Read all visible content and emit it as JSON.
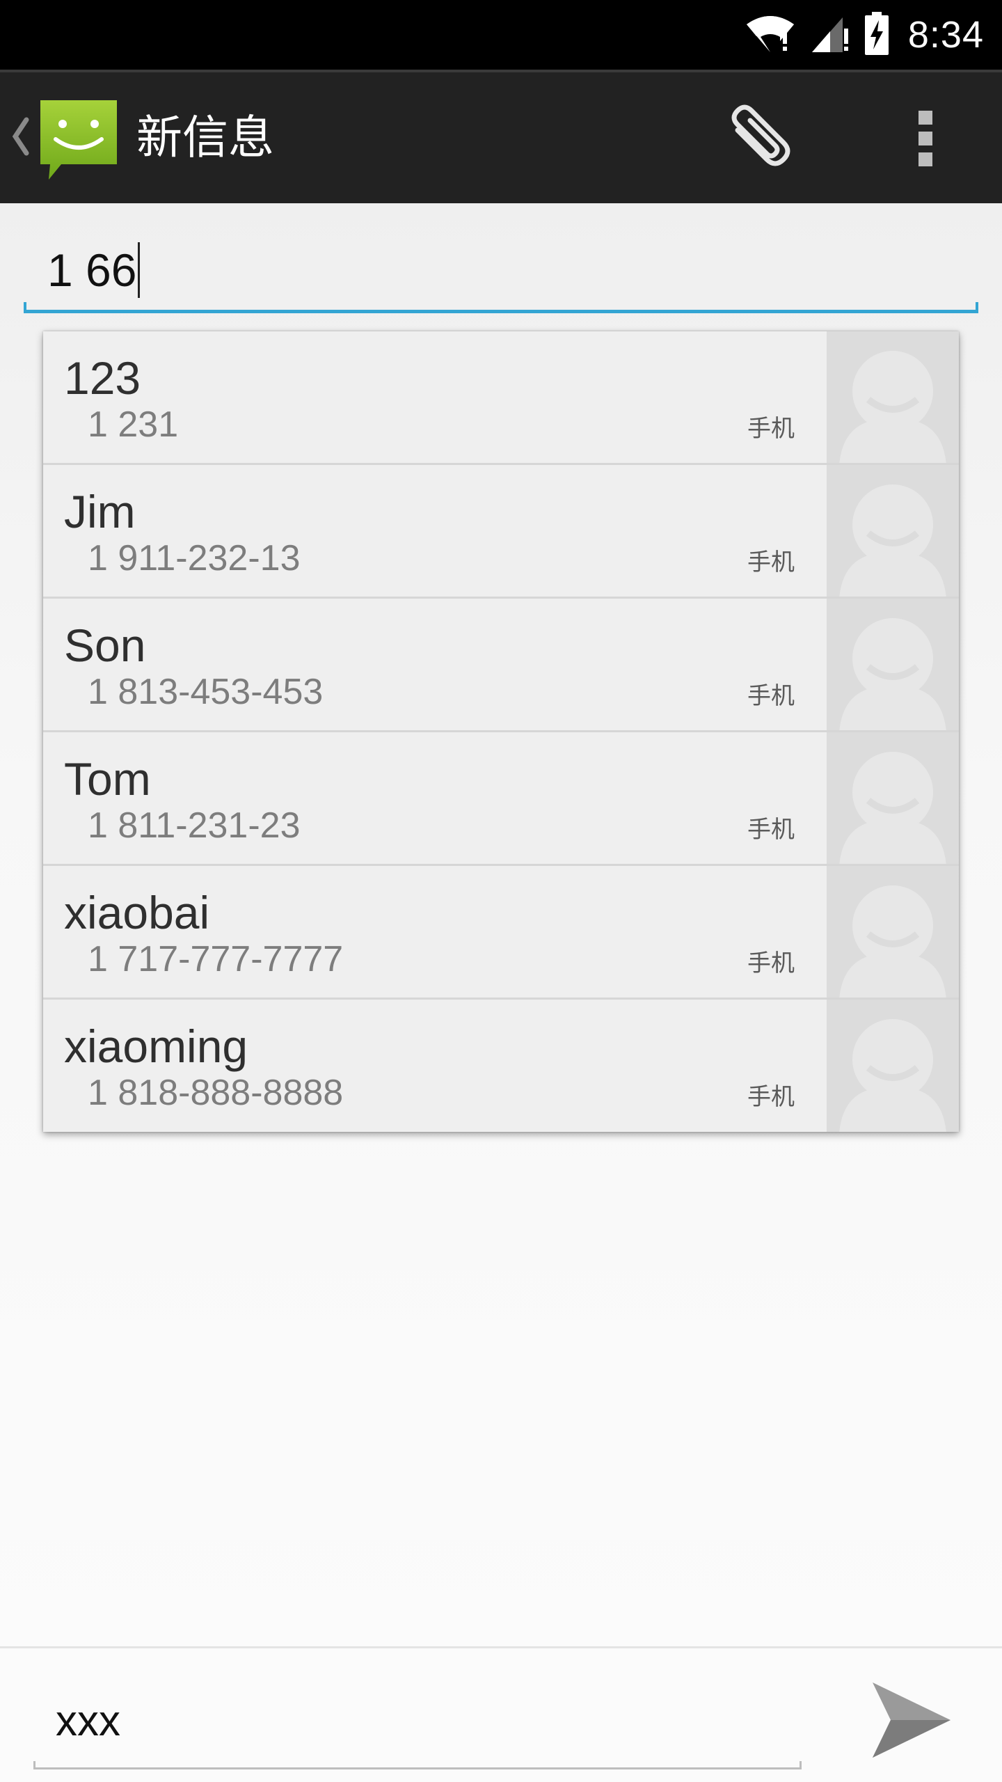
{
  "status_bar": {
    "time": "8:34",
    "icons": [
      "wifi-no-internet-icon",
      "cell-signal-no-data-icon",
      "battery-charging-icon"
    ]
  },
  "action_bar": {
    "title": "新信息",
    "icons": [
      "up-chevron-icon",
      "messaging-app-logo-icon",
      "paperclip-attach-icon",
      "overflow-menu-icon"
    ],
    "background": "#222222"
  },
  "recipient": {
    "value": "1 66",
    "underline_color": "#33a5d3"
  },
  "suggestions": [
    {
      "name": "123",
      "number": "1 231",
      "type": "手机"
    },
    {
      "name": "Jim",
      "number": "1 911-232-13",
      "type": "手机"
    },
    {
      "name": "Son",
      "number": "1 813-453-453",
      "type": "手机"
    },
    {
      "name": "Tom",
      "number": "1 811-231-23",
      "type": "手机"
    },
    {
      "name": "xiaobai",
      "number": "1 717-777-7777",
      "type": "手机"
    },
    {
      "name": "xiaoming",
      "number": "1 818-888-8888",
      "type": "手机"
    }
  ],
  "compose": {
    "value": "xxx",
    "send_icon": "send-arrow-icon"
  }
}
